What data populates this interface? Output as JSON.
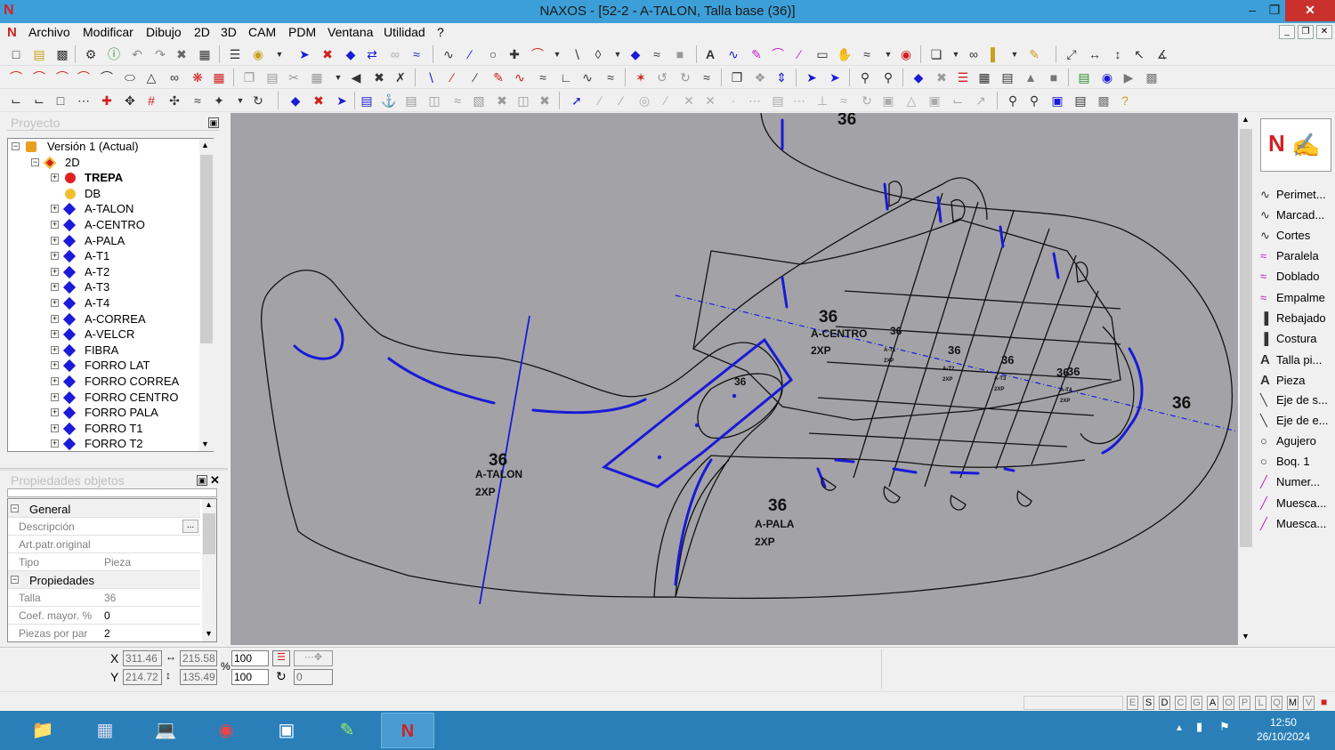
{
  "window": {
    "title": "NAXOS - [52-2 - A-TALON, Talla base (36)]",
    "logo": "N",
    "minimize": "–",
    "restore": "❐",
    "close": "✕"
  },
  "menu": {
    "items": [
      "Archivo",
      "Modificar",
      "Dibujo",
      "2D",
      "3D",
      "CAM",
      "PDM",
      "Ventana",
      "Utilidad",
      "?"
    ],
    "mdi_minimize": "_",
    "mdi_restore": "❐",
    "mdi_close": "✕"
  },
  "project_panel": {
    "title": "Proyecto",
    "tree": [
      {
        "label": "Versión 1 (Actual)",
        "icon": "version-icon",
        "level": 0,
        "expander": "−"
      },
      {
        "label": "2D",
        "icon": "2d-icon",
        "level": 1,
        "expander": "−"
      },
      {
        "label": "TREPA",
        "icon": "red-dot",
        "level": 2,
        "expander": "+",
        "bold": true
      },
      {
        "label": "DB",
        "icon": "yellow-dot",
        "level": 2,
        "expander": ""
      },
      {
        "label": "A-TALON",
        "icon": "diamond",
        "level": 2,
        "expander": "+"
      },
      {
        "label": "A-CENTRO",
        "icon": "diamond",
        "level": 2,
        "expander": "+"
      },
      {
        "label": "A-PALA",
        "icon": "diamond",
        "level": 2,
        "expander": "+"
      },
      {
        "label": "A-T1",
        "icon": "diamond",
        "level": 2,
        "expander": "+"
      },
      {
        "label": "A-T2",
        "icon": "diamond",
        "level": 2,
        "expander": "+"
      },
      {
        "label": "A-T3",
        "icon": "diamond",
        "level": 2,
        "expander": "+"
      },
      {
        "label": "A-T4",
        "icon": "diamond",
        "level": 2,
        "expander": "+"
      },
      {
        "label": "A-CORREA",
        "icon": "diamond",
        "level": 2,
        "expander": "+"
      },
      {
        "label": "A-VELCR",
        "icon": "diamond",
        "level": 2,
        "expander": "+"
      },
      {
        "label": "FIBRA",
        "icon": "diamond",
        "level": 2,
        "expander": "+"
      },
      {
        "label": "FORRO LAT",
        "icon": "diamond",
        "level": 2,
        "expander": "+"
      },
      {
        "label": "FORRO CORREA",
        "icon": "diamond",
        "level": 2,
        "expander": "+"
      },
      {
        "label": "FORRO CENTRO",
        "icon": "diamond",
        "level": 2,
        "expander": "+"
      },
      {
        "label": "FORRO PALA",
        "icon": "diamond",
        "level": 2,
        "expander": "+"
      },
      {
        "label": "FORRO T1",
        "icon": "diamond",
        "level": 2,
        "expander": "+"
      },
      {
        "label": "FORRO T2",
        "icon": "diamond",
        "level": 2,
        "expander": "+"
      }
    ]
  },
  "properties_panel": {
    "title": "Propiedades objetos",
    "general_label": "General",
    "descripcion_label": "Descripción",
    "descripcion_value": "",
    "descripcion_btn": "...",
    "art_label": "Art.patr.original",
    "art_value": "",
    "tipo_label": "Tipo",
    "tipo_value": "Pieza",
    "propiedades_label": "Propiedades",
    "talla_label": "Talla",
    "talla_value": "36",
    "coef_label": "Coef. mayor. %",
    "coef_value": "0",
    "piezas_label": "Piezas por par",
    "piezas_value": "2"
  },
  "canvas": {
    "background": "#a3a3a7",
    "labels": [
      {
        "id": "top",
        "size": "36"
      },
      {
        "id": "talon",
        "size": "36",
        "name": "A-TALON",
        "qty": "2XP"
      },
      {
        "id": "centro",
        "size": "36",
        "name": "A-CENTRO",
        "qty": "2XP"
      },
      {
        "id": "pala",
        "size": "36",
        "name": "A-PALA",
        "qty": "2XP"
      },
      {
        "id": "right",
        "size": "36"
      },
      {
        "id": "small1",
        "size": "36"
      },
      {
        "id": "t1",
        "size": "36",
        "name": "A-T1",
        "qty": "2XP"
      },
      {
        "id": "t2",
        "size": "36",
        "name": "A-T2",
        "qty": "2XP"
      },
      {
        "id": "t3",
        "size": "36",
        "name": "A-T3",
        "qty": "2XP"
      },
      {
        "id": "t4",
        "size": "36",
        "name": "A-T4",
        "qty": "2XP"
      },
      {
        "id": "mid",
        "size": "36"
      }
    ]
  },
  "right_panel": {
    "items": [
      {
        "label": "Perimet...",
        "icon": "wave-icon"
      },
      {
        "label": "Marcad...",
        "icon": "wave-icon"
      },
      {
        "label": "Cortes",
        "icon": "wave-icon"
      },
      {
        "label": "Paralela",
        "icon": "parallel-icon"
      },
      {
        "label": "Doblado",
        "icon": "fold-icon"
      },
      {
        "label": "Empalme",
        "icon": "join-icon"
      },
      {
        "label": "Rebajado",
        "icon": "skive-icon"
      },
      {
        "label": "Costura",
        "icon": "stitch-icon"
      },
      {
        "label": "Talla pi...",
        "icon": "text-icon"
      },
      {
        "label": "Pieza",
        "icon": "text-icon"
      },
      {
        "label": "Eje de s...",
        "icon": "axis-icon"
      },
      {
        "label": "Eje de e...",
        "icon": "axis-icon"
      },
      {
        "label": "Agujero",
        "icon": "circle-icon"
      },
      {
        "label": "Boq. 1",
        "icon": "circle-icon"
      },
      {
        "label": "Numer...",
        "icon": "notch-icon"
      },
      {
        "label": "Muesca...",
        "icon": "notch-icon"
      },
      {
        "label": "Muesca...",
        "icon": "notch-icon"
      }
    ]
  },
  "status": {
    "x_label": "X",
    "y_label": "Y",
    "x_value": "311.46",
    "y_value": "214.72",
    "w_value": "215.58",
    "h_value": "135.49",
    "scale_x": "100",
    "scale_y": "100",
    "percent": "%",
    "rotation": "0"
  },
  "flags": [
    "E",
    "S",
    "D",
    "C",
    "G",
    "A",
    "O",
    "P",
    "L",
    "Q",
    "M",
    "V"
  ],
  "taskbar": {
    "time": "12:50",
    "date": "26/10/2024"
  }
}
